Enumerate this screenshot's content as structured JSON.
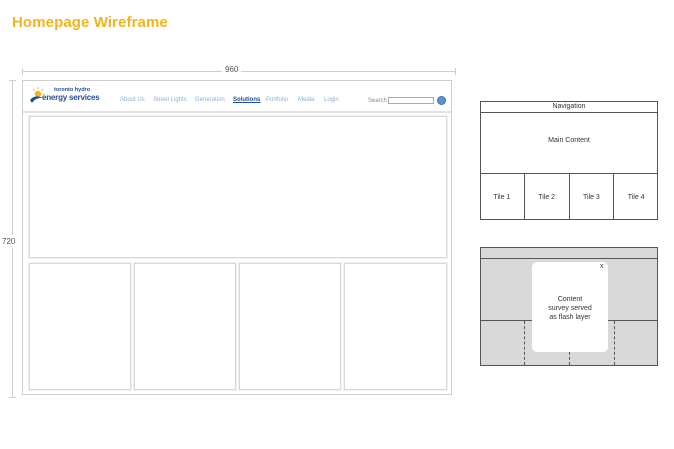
{
  "page": {
    "title": "Homepage Wireframe"
  },
  "dimensions": {
    "width_label": "960",
    "height_label": "720"
  },
  "site": {
    "logo": {
      "line1": "toronto hydro",
      "line2": "energy services"
    },
    "nav": [
      {
        "label": "About Us",
        "active": false
      },
      {
        "label": "Street Lights",
        "active": false
      },
      {
        "label": "Generation",
        "active": false
      },
      {
        "label": "Solutions",
        "active": true
      },
      {
        "label": "Portfolio",
        "active": false
      },
      {
        "label": "Media",
        "active": false
      },
      {
        "label": "Login",
        "active": false
      }
    ],
    "search": {
      "label": "Search",
      "placeholder": "",
      "value": ""
    }
  },
  "layout_legend": {
    "navigation": "Navigation",
    "main_content": "Main Content",
    "tiles": [
      "Tile 1",
      "Tile 2",
      "Tile 3",
      "Tile 4"
    ]
  },
  "overlay_legend": {
    "close": "x",
    "text": "Content survey served as flash layer"
  },
  "colors": {
    "title": "#f4b31c",
    "brand": "#1f4e9a",
    "nav": "#8ab0d6",
    "overlay": "#d9d9d9"
  },
  "icons": [
    "hydro-logo-icon",
    "search-go-icon",
    "close-icon"
  ]
}
